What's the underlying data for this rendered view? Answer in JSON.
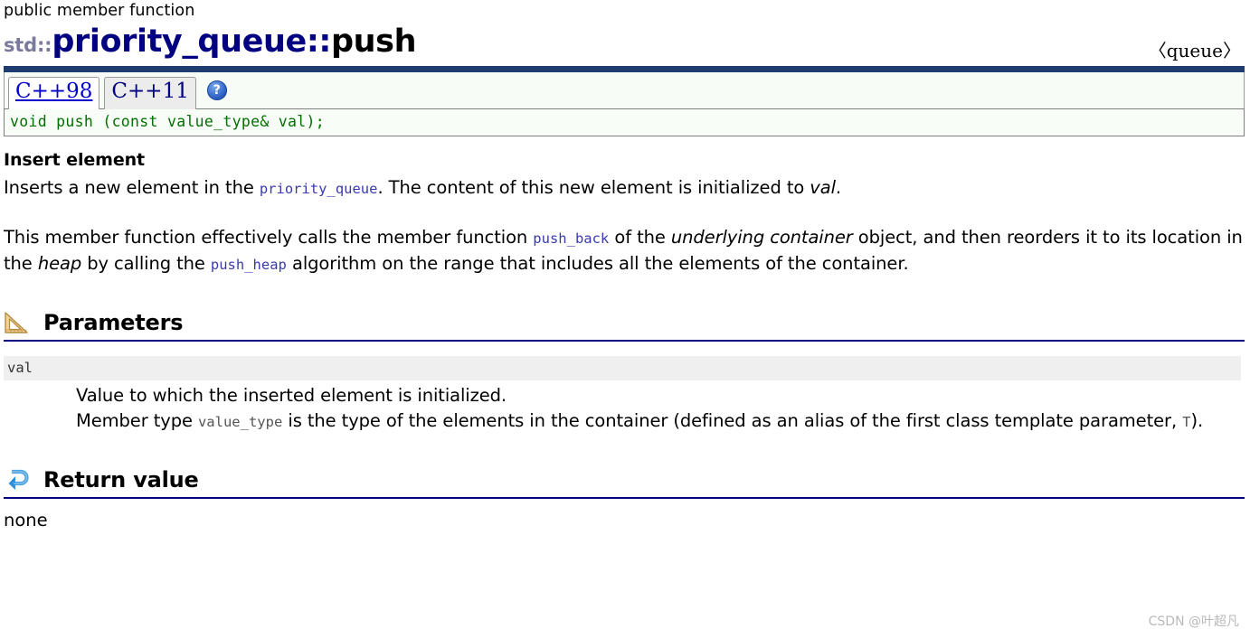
{
  "header": {
    "kind": "public member function",
    "namespace": "std::",
    "class_name": "priority_queue",
    "scope_sep": "::",
    "function_name": "push",
    "include_header": "〈queue〉",
    "rule_color": "#1f3c70"
  },
  "tabs": {
    "items": [
      {
        "label": "C++98",
        "active": true
      },
      {
        "label": "C++11",
        "active": false
      }
    ],
    "help_icon": "help-question-icon",
    "help_glyph": "?"
  },
  "prototype": {
    "signature": "void push (const value_type& val);",
    "code_color": "#007000"
  },
  "summary": {
    "heading": "Insert element",
    "paragraph1": {
      "part1": "Inserts a new element in the ",
      "code1": "priority_queue",
      "part2": ". The content of this new element is initialized to ",
      "italic1": "val",
      "part3": "."
    },
    "paragraph2": {
      "part1": "This member function effectively calls the member function ",
      "code1": "push_back",
      "part2": " of the ",
      "italic1": "underlying container",
      "part3": " object, and then reorders it to its location in the ",
      "italic2": "heap",
      "part4": " by calling the ",
      "code2": "push_heap",
      "part5": " algorithm on the range that includes all the elements of the container."
    }
  },
  "sections": {
    "parameters": {
      "title": "Parameters",
      "icon": "ruler-triangle-icon",
      "rows": [
        {
          "name": "val",
          "desc_line1": "Value to which the inserted element is initialized.",
          "desc_line2_part1": "Member type ",
          "desc_line2_code1": "value_type",
          "desc_line2_part2": " is the type of the elements in the container (defined as an alias of the first class template parameter, ",
          "desc_line2_code2": "T",
          "desc_line2_part3": ")."
        }
      ]
    },
    "return_value": {
      "title": "Return value",
      "icon": "return-arrow-icon",
      "text": "none"
    }
  },
  "watermark": {
    "text": "CSDN @叶超凡"
  }
}
